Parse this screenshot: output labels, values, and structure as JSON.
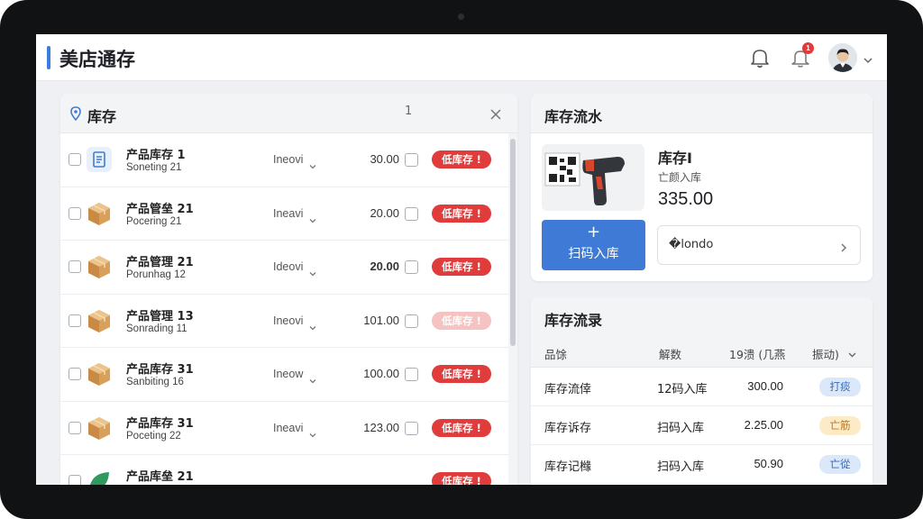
{
  "app": {
    "title": "美店通存",
    "notification_count": "1"
  },
  "colors": {
    "accent": "#3f7bd6",
    "danger": "#e03c3c",
    "warning": "#f3a53a"
  },
  "inventory_panel": {
    "title": "库存",
    "pager": "1",
    "rows": [
      {
        "name": "产品库存 1",
        "sub": "Soneting 21",
        "unit": "Ineovi",
        "qty": "30.00",
        "tag": "低库存 !",
        "icon": "document-icon"
      },
      {
        "name": "产品管垒 21",
        "sub": "Pocering 21",
        "unit": "Ineavi",
        "qty": "20.00",
        "tag": "低库存 !",
        "icon": "box-icon"
      },
      {
        "name": "产品管理 21",
        "sub": "Porunhag 12",
        "unit": "Ideovi",
        "qty": "20.00",
        "tag": "低库存 !",
        "icon": "box-icon"
      },
      {
        "name": "产品管理 13",
        "sub": "Sonrading 11",
        "unit": "Ineovi",
        "qty": "101.00",
        "tag": "低库存 !",
        "icon": "box-icon"
      },
      {
        "name": "产品库存 31",
        "sub": "Sanbiting 16",
        "unit": "Ineow",
        "qty": "100.00",
        "tag": "低库存 !",
        "icon": "box-icon"
      },
      {
        "name": "产品库存 31",
        "sub": "Poceting 22",
        "unit": "Ineavi",
        "qty": "123.00",
        "tag": "低库存 !",
        "icon": "box-icon"
      },
      {
        "name": "产品库垒 21",
        "sub": "",
        "unit": "",
        "qty": "",
        "tag": "低库存 !",
        "icon": "leaf-icon"
      }
    ]
  },
  "flow_panel": {
    "title": "库存流水",
    "item_name": "库存I",
    "item_sub": "亡颜入库",
    "item_value": "335.00",
    "scan_plus": "+",
    "scan_label": "扫码入库",
    "filter_label": "�londo"
  },
  "records_panel": {
    "title": "库存流录",
    "headers": [
      "品馀",
      "解数",
      "19溃 (几燕",
      "振动)"
    ],
    "rows": [
      {
        "c1": "库存流倖",
        "c2": "12码入库",
        "c3": "300.00",
        "pill": "打痰",
        "pill_bg": "#dbe8fa",
        "pill_fg": "#3569b8"
      },
      {
        "c1": "库存诉存",
        "c2": "扫码入库",
        "c3": "2.25.00",
        "pill": "亡筋",
        "pill_bg": "#fdebc8",
        "pill_fg": "#b9791a"
      },
      {
        "c1": "库存记橼",
        "c2": "扫码入库",
        "c3": "50.90",
        "pill": "亡從",
        "pill_bg": "#dbe8fa",
        "pill_fg": "#3569b8"
      }
    ]
  }
}
